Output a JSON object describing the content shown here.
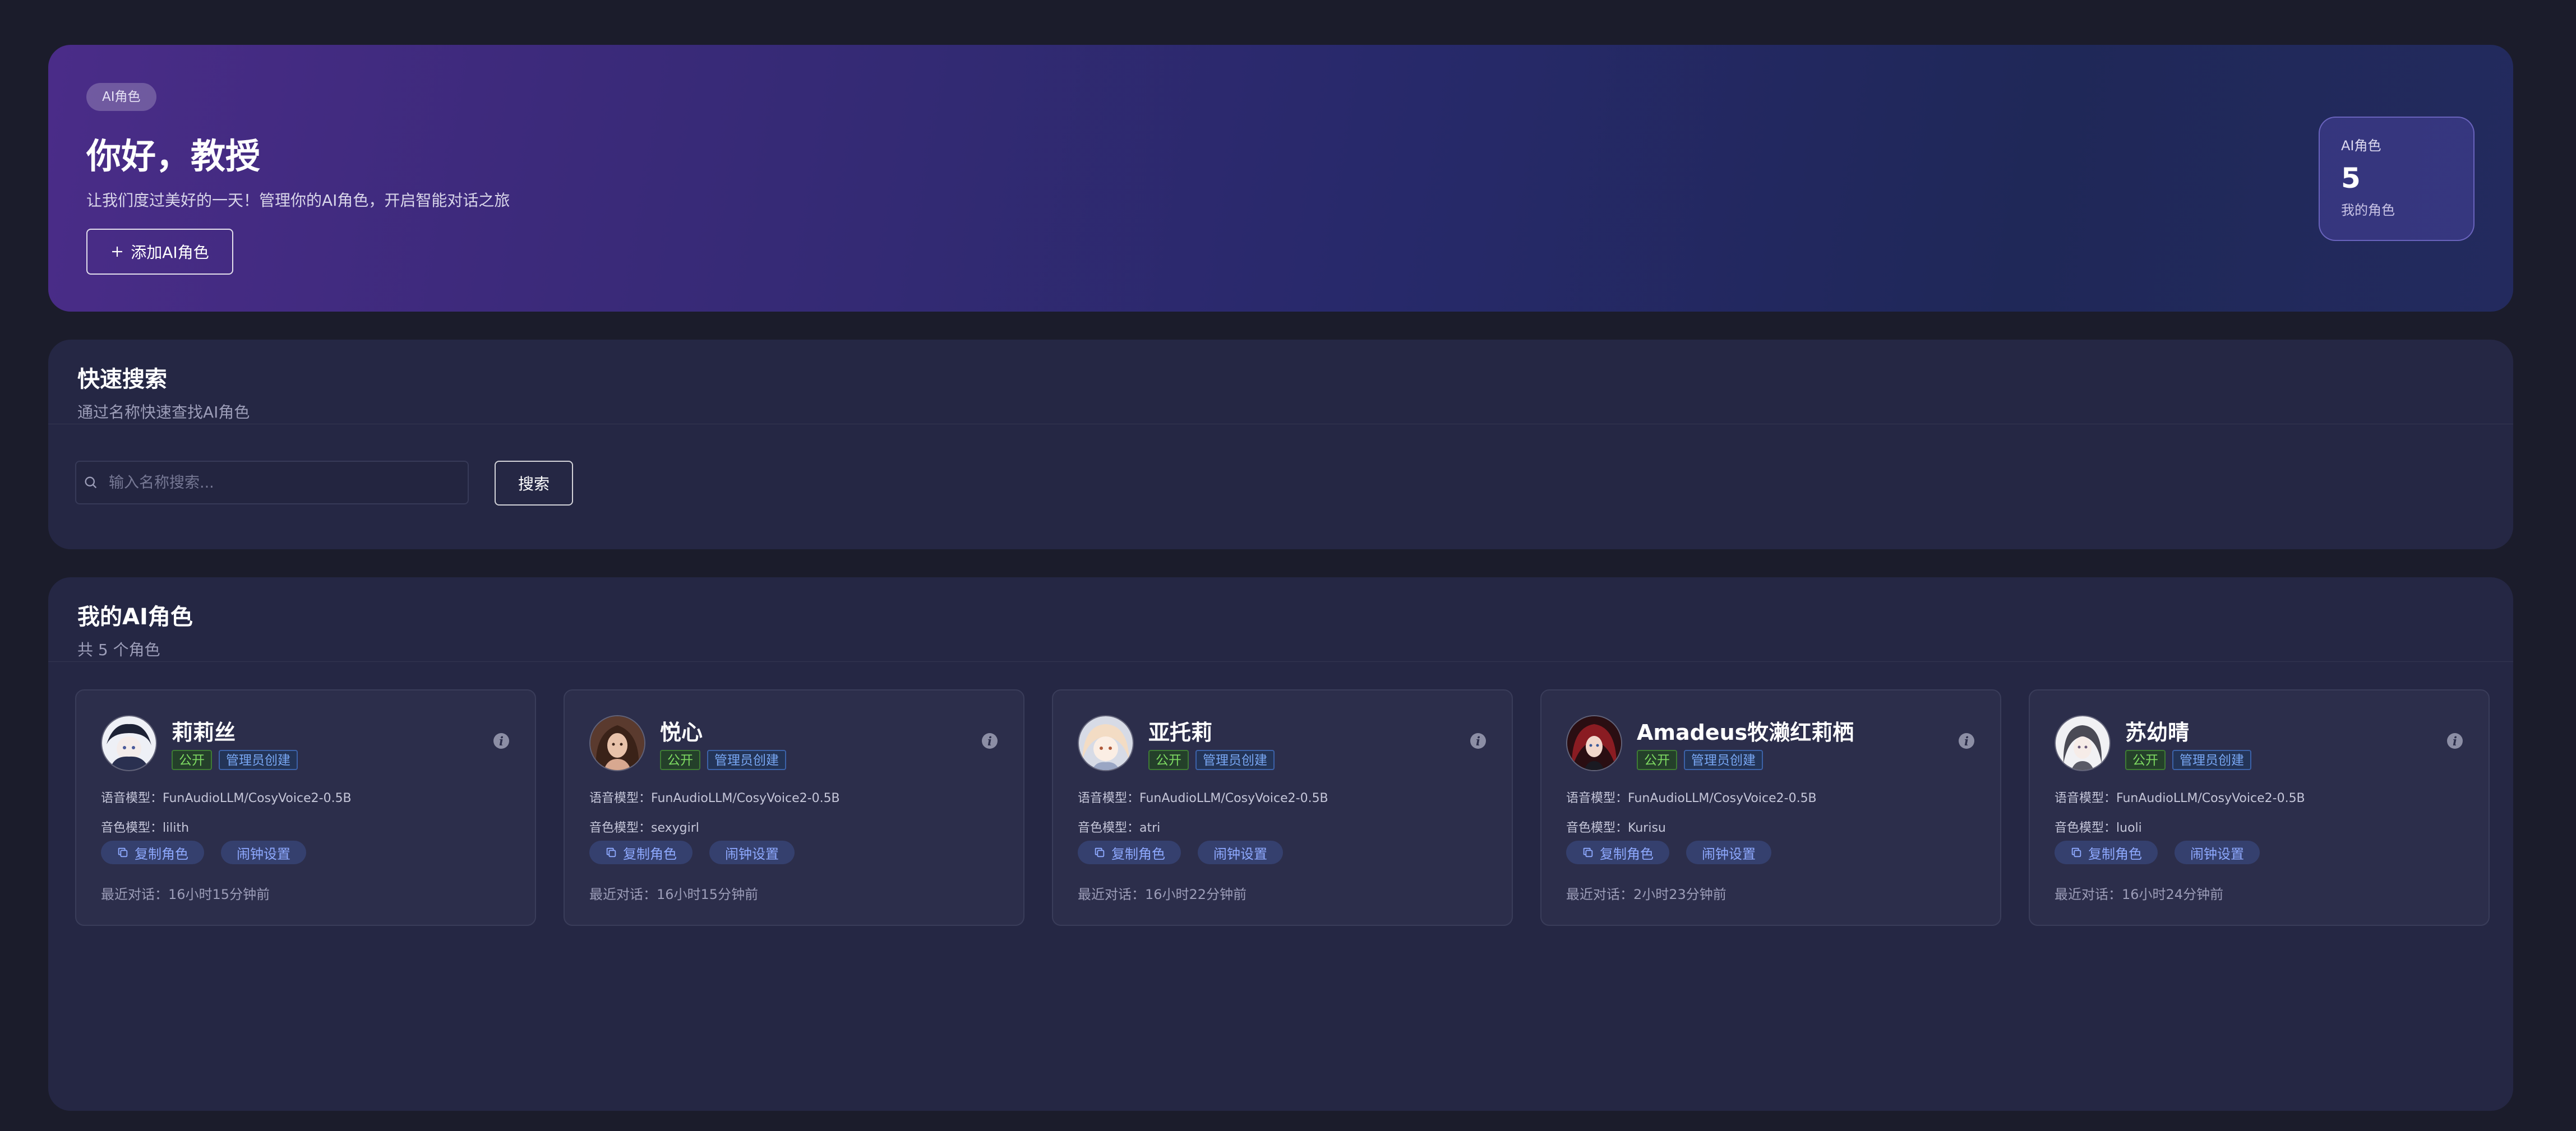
{
  "hero": {
    "badge": "AI角色",
    "title": "你好，教授",
    "subtitle": "让我们度过美好的一天！管理你的AI角色，开启智能对话之旅",
    "add_button_label": "添加AI角色",
    "stat": {
      "label": "AI角色",
      "value": "5",
      "sub": "我的角色"
    }
  },
  "search": {
    "title": "快速搜索",
    "subtitle": "通过名称快速查找AI角色",
    "placeholder": "输入名称搜索...",
    "button_label": "搜索"
  },
  "characters": {
    "title": "我的AI角色",
    "count_text": "共 5 个角色",
    "items": [
      {
        "name": "莉莉丝",
        "tag_public": "公开",
        "tag_creator": "管理员创建",
        "voice_model_label": "语音模型：",
        "voice_model": "FunAudioLLM/CosyVoice2-0.5B",
        "tone_model_label": "音色模型：",
        "tone_model": "lilith",
        "copy_label": "复制角色",
        "alarm_label": "闹钟设置",
        "last_chat_label": "最近对话：",
        "last_chat": "16小时15分钟前"
      },
      {
        "name": "悦心",
        "tag_public": "公开",
        "tag_creator": "管理员创建",
        "voice_model_label": "语音模型：",
        "voice_model": "FunAudioLLM/CosyVoice2-0.5B",
        "tone_model_label": "音色模型：",
        "tone_model": "sexygirl",
        "copy_label": "复制角色",
        "alarm_label": "闹钟设置",
        "last_chat_label": "最近对话：",
        "last_chat": "16小时15分钟前"
      },
      {
        "name": "亚托莉",
        "tag_public": "公开",
        "tag_creator": "管理员创建",
        "voice_model_label": "语音模型：",
        "voice_model": "FunAudioLLM/CosyVoice2-0.5B",
        "tone_model_label": "音色模型：",
        "tone_model": "atri",
        "copy_label": "复制角色",
        "alarm_label": "闹钟设置",
        "last_chat_label": "最近对话：",
        "last_chat": "16小时22分钟前"
      },
      {
        "name": "Amadeus牧濑红莉栖",
        "tag_public": "公开",
        "tag_creator": "管理员创建",
        "voice_model_label": "语音模型：",
        "voice_model": "FunAudioLLM/CosyVoice2-0.5B",
        "tone_model_label": "音色模型：",
        "tone_model": "Kurisu",
        "copy_label": "复制角色",
        "alarm_label": "闹钟设置",
        "last_chat_label": "最近对话：",
        "last_chat": "2小时23分钟前"
      },
      {
        "name": "苏幼晴",
        "tag_public": "公开",
        "tag_creator": "管理员创建",
        "voice_model_label": "语音模型：",
        "voice_model": "FunAudioLLM/CosyVoice2-0.5B",
        "tone_model_label": "音色模型：",
        "tone_model": "luoli",
        "copy_label": "复制角色",
        "alarm_label": "闹钟设置",
        "last_chat_label": "最近对话：",
        "last_chat": "16小时24分钟前"
      }
    ]
  },
  "colors": {
    "accent": "#8ea9ff",
    "tag_green": "#7edb62",
    "tag_blue": "#78a6f2",
    "panel": "#252744",
    "background": "#1b1c2b"
  },
  "icons": {
    "add": "plus-icon",
    "search": "search-icon",
    "info": "info-icon",
    "copy": "copy-icon"
  }
}
